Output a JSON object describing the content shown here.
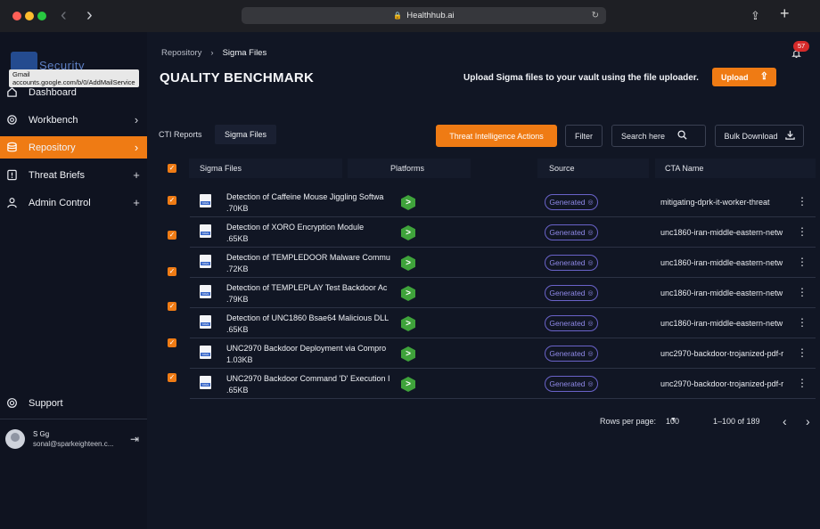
{
  "browser": {
    "url": "Healthhub.ai",
    "tooltip_title": "Gmail",
    "tooltip_url": "accounts.google.com/b/0/AddMailService"
  },
  "sidebar": {
    "logo_text": "Security",
    "items": [
      {
        "label": "Dashboard",
        "icon": "home-icon",
        "tail": ""
      },
      {
        "label": "Workbench",
        "icon": "settings-icon",
        "tail": "›"
      },
      {
        "label": "Repository",
        "icon": "database-icon",
        "tail": "›",
        "active": true
      },
      {
        "label": "Threat Briefs",
        "icon": "alert-icon",
        "tail": "+"
      },
      {
        "label": "Admin Control",
        "icon": "user-icon",
        "tail": "+"
      }
    ],
    "support_label": "Support",
    "user_name": "S Gg",
    "user_email": "sonal@sparkeighteen.c..."
  },
  "header": {
    "breadcrumb_root": "Repository",
    "breadcrumb_current": "Sigma Files",
    "title": "QUALITY BENCHMARK",
    "upload_hint": "Upload Sigma files to your vault using the file uploader.",
    "upload_label": "Upload",
    "notification_count": "57"
  },
  "tabs": [
    {
      "label": "CTI Reports"
    },
    {
      "label": "Sigma Files",
      "active": true
    }
  ],
  "toolbar": {
    "threat_intel_label": "Threat Intelligence Actions",
    "filter_label": "Filter",
    "search_label": "Search here",
    "bulk_download_label": "Bulk Download"
  },
  "table": {
    "columns": [
      "Sigma Files",
      "Platforms",
      "Source",
      "CTA Name"
    ],
    "rows": [
      {
        "name": "Detection of Caffeine Mouse Jiggling Softwa",
        "size": ".70KB",
        "platform": ">",
        "source": "Generated",
        "cta": "mitigating-dprk-it-worker-threat"
      },
      {
        "name": "Detection of XORO Encryption Module",
        "size": ".65KB",
        "platform": ">",
        "source": "Generated",
        "cta": "unc1860-iran-middle-eastern-netw"
      },
      {
        "name": "Detection of TEMPLEDOOR Malware Commu",
        "size": ".72KB",
        "platform": ">",
        "source": "Generated",
        "cta": "unc1860-iran-middle-eastern-netw"
      },
      {
        "name": "Detection of TEMPLEPLAY Test Backdoor Ac",
        "size": ".79KB",
        "platform": ">",
        "source": "Generated",
        "cta": "unc1860-iran-middle-eastern-netw"
      },
      {
        "name": "Detection of UNC1860 Bsae64 Malicious DLL",
        "size": ".65KB",
        "platform": ">",
        "source": "Generated",
        "cta": "unc1860-iran-middle-eastern-netw"
      },
      {
        "name": "UNC2970 Backdoor Deployment via Compro",
        "size": "1.03KB",
        "platform": ">",
        "source": "Generated",
        "cta": "unc2970-backdoor-trojanized-pdf-r"
      },
      {
        "name": "UNC2970 Backdoor Command 'D' Execution I",
        "size": ".65KB",
        "platform": ">",
        "source": "Generated",
        "cta": "unc2970-backdoor-trojanized-pdf-r"
      }
    ]
  },
  "pagination": {
    "rows_per_page_label": "Rows per page:",
    "rows_per_page_value": "100",
    "range": "1–100 of 189"
  },
  "colors": {
    "accent": "#ef7b14",
    "background": "#111624",
    "sidebar": "#0f1320",
    "source_badge": "#6a63c9",
    "platform_hex": "#3fa33b"
  }
}
